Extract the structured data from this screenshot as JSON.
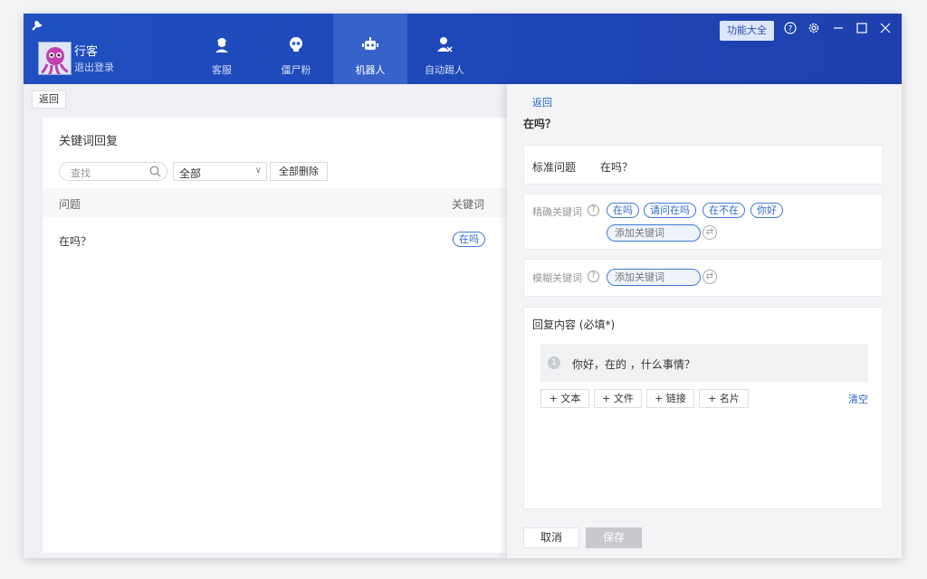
{
  "header": {
    "user_name": "行客",
    "logout_label": "退出登录",
    "feature_button": "功能大全",
    "tabs": [
      {
        "label": "客服",
        "icon": "support-agent-icon"
      },
      {
        "label": "僵尸粉",
        "icon": "skull-icon"
      },
      {
        "label": "机器人",
        "icon": "robot-icon",
        "active": true
      },
      {
        "label": "自动踢人",
        "icon": "kick-user-icon"
      }
    ]
  },
  "toolbar": {
    "back_label": "返回"
  },
  "keyword_list": {
    "title": "关键词回复",
    "search_placeholder": "查找",
    "filter_value": "全部",
    "delete_all_label": "全部删除",
    "columns": [
      "问题",
      "关键词"
    ],
    "rows": [
      {
        "question": "在吗？",
        "keyword": "在吗"
      }
    ]
  },
  "detail": {
    "back_label": "返回",
    "title": "在吗？",
    "standard_question_label": "标准问题",
    "standard_question_value": "在吗？",
    "exact_keywords_label": "精确关键词",
    "exact_keywords": [
      "在吗",
      "请问在吗",
      "在不在",
      "你好"
    ],
    "add_keyword_placeholder": "添加关键词",
    "fuzzy_keywords_label": "模糊关键词",
    "reply_label": "回复内容 (必填*)",
    "reply_index": "1",
    "reply_text": "你好，在的 ，什么事情？",
    "add_text": "+ 文本",
    "add_file": "+ 文件",
    "add_link": "+ 链接",
    "add_card": "+ 名片",
    "clear_label": "清空",
    "cancel_label": "取消",
    "save_label": "保存"
  },
  "colors": {
    "header_blue": "#1f4fc0",
    "accent": "#2b67c7"
  }
}
